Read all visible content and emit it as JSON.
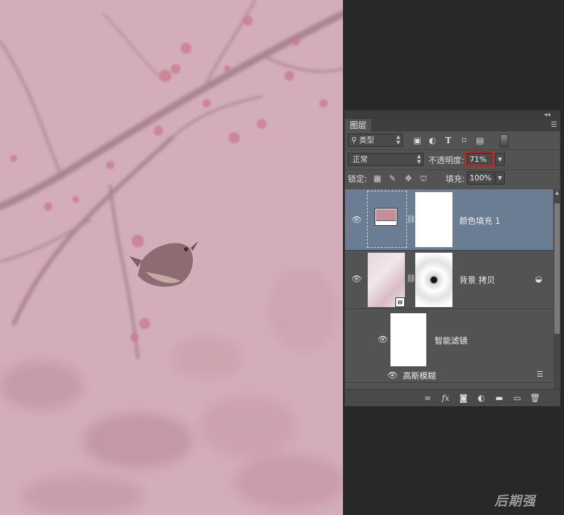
{
  "panel": {
    "tab_label": "图层",
    "collapse_icon": "double-chevron-left-icon",
    "menu_icon": "panel-menu-icon"
  },
  "filter": {
    "kind_label": "类型",
    "search_icon": "search-icon",
    "icons": [
      "image-filter-icon",
      "adjustment-filter-icon",
      "type-filter-icon",
      "shape-filter-icon",
      "smart-object-filter-icon"
    ]
  },
  "blend": {
    "mode": "正常",
    "opacity_label": "不透明度:",
    "opacity_value": "71%",
    "highlight_color": "#e0141e"
  },
  "lock": {
    "label": "锁定:",
    "fill_label": "填充:",
    "fill_value": "100%"
  },
  "layers": [
    {
      "name": "颜色填充 1",
      "selected": true,
      "fill_color": "#c48f99"
    },
    {
      "name": "背景 拷贝",
      "selected": false
    },
    {
      "name": "智能滤镜",
      "selected": false
    },
    {
      "name": "高斯模糊",
      "selected": false
    }
  ],
  "toolbar_icons": [
    "link-layers-icon",
    "fx-icon",
    "add-mask-icon",
    "new-adjustment-icon",
    "new-group-icon",
    "new-layer-icon",
    "delete-icon"
  ],
  "watermark": "后期强",
  "colors": {
    "canvas_bg": "#d4afbb",
    "panel_bg": "#535353",
    "selected_row": "#6a7d93"
  }
}
